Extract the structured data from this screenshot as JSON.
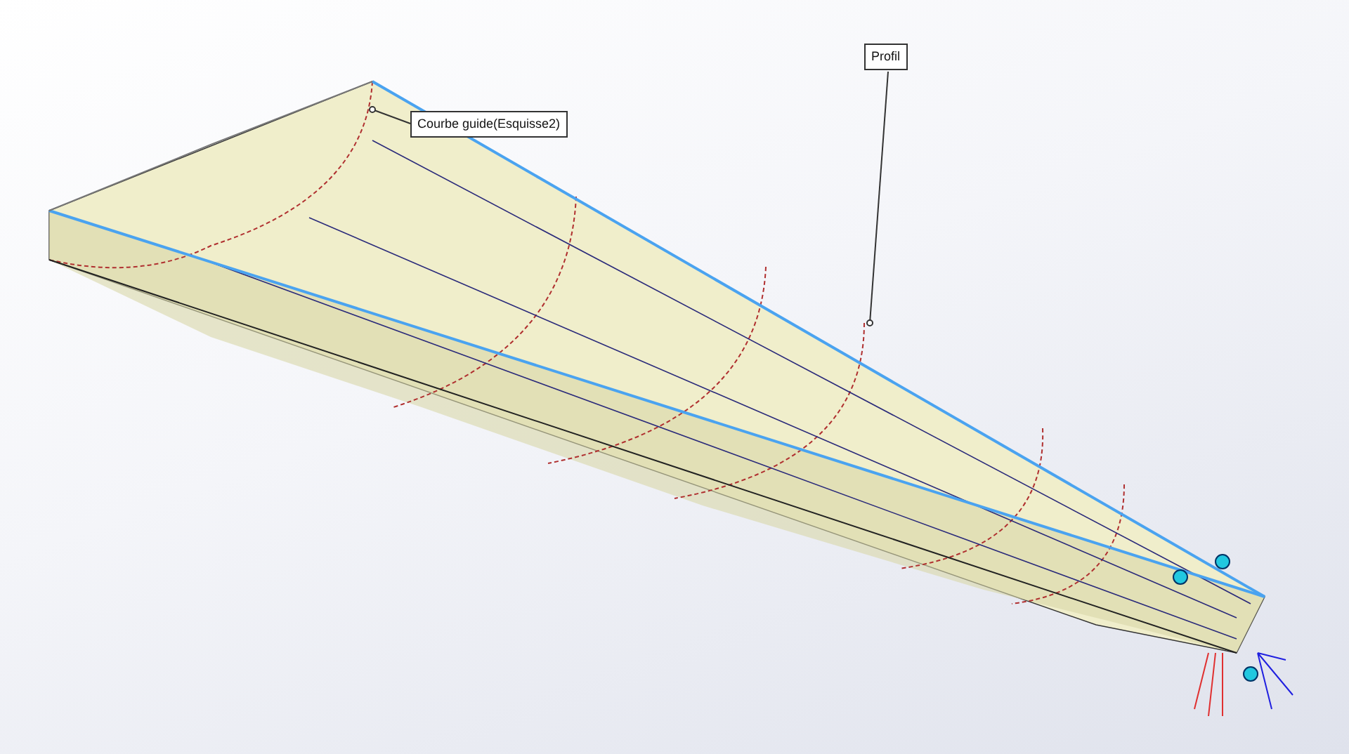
{
  "viewport": {
    "callouts": [
      {
        "label": "Courbe guide(Esquisse2)"
      },
      {
        "label": "Profil"
      }
    ]
  }
}
